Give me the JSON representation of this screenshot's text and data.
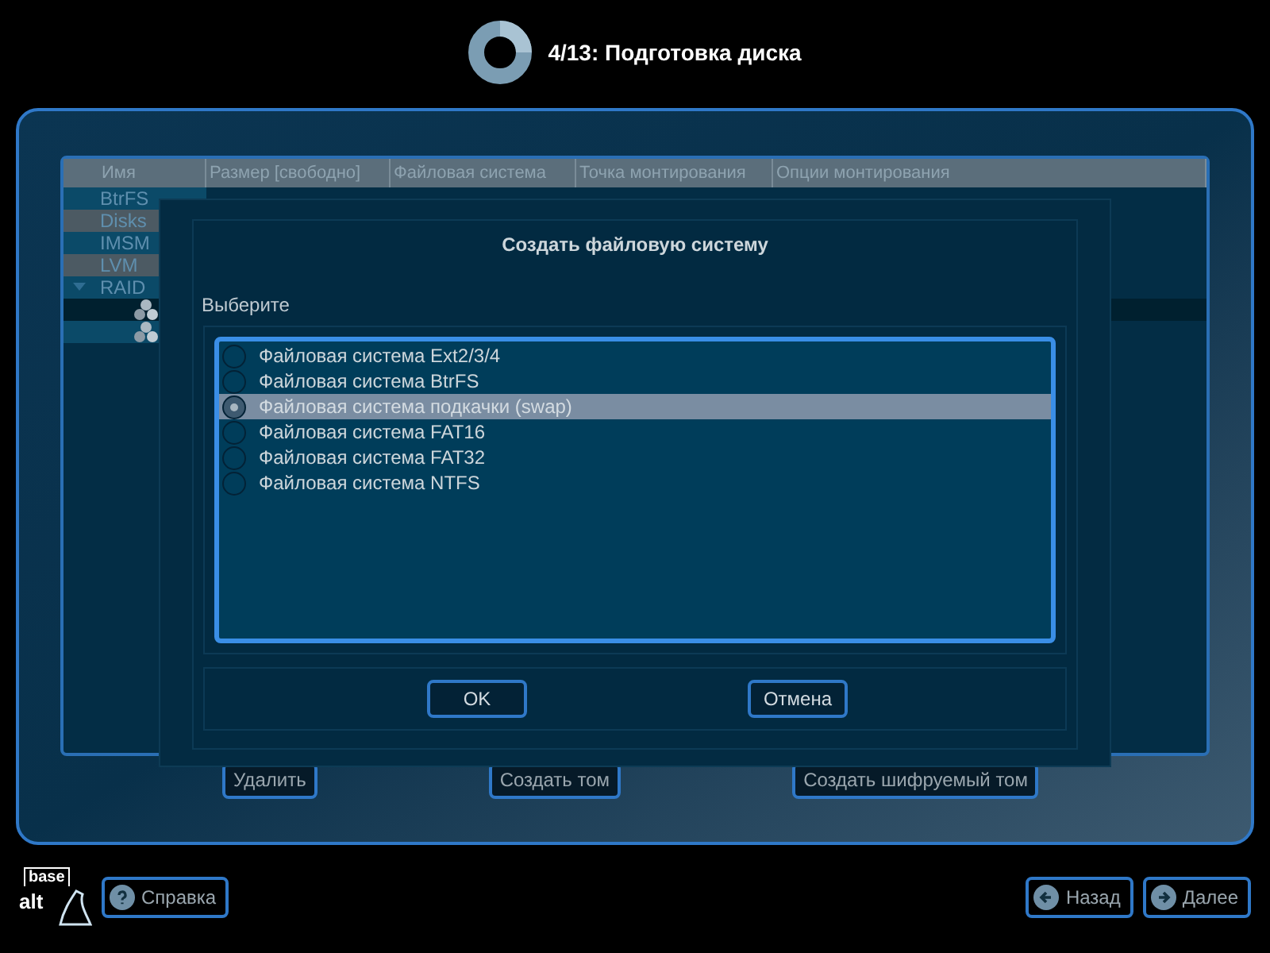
{
  "header": {
    "title": "4/13: Подготовка диска"
  },
  "table": {
    "columns": [
      "Имя",
      "Размер [свободно]",
      "Файловая система",
      "Точка монтирования",
      "Опции монтирования"
    ],
    "tree": [
      {
        "label": "BtrFS"
      },
      {
        "label": "Disks"
      },
      {
        "label": "IMSM"
      },
      {
        "label": "LVM"
      },
      {
        "label": "RAID",
        "expanded": true,
        "children": [
          {
            "selected": true
          },
          {
            "selected": false
          }
        ]
      }
    ]
  },
  "actions": [
    "Удалить",
    "Создать том",
    "Создать шифруемый том"
  ],
  "dialog": {
    "title": "Создать файловую систему",
    "prompt": "Выберите",
    "options": [
      {
        "label": "Файловая система Ext2/3/4",
        "selected": false
      },
      {
        "label": "Файловая система BtrFS",
        "selected": false
      },
      {
        "label": "Файловая система подкачки (swap)",
        "selected": true
      },
      {
        "label": "Файловая система FAT16",
        "selected": false
      },
      {
        "label": "Файловая система FAT32",
        "selected": false
      },
      {
        "label": "Файловая система NTFS",
        "selected": false
      }
    ],
    "buttons": [
      "OK",
      "Отмена"
    ]
  },
  "footer": {
    "logo_top": "base",
    "logo_bottom": "alt",
    "help": "Справка",
    "back": "Назад",
    "next": "Далее"
  }
}
